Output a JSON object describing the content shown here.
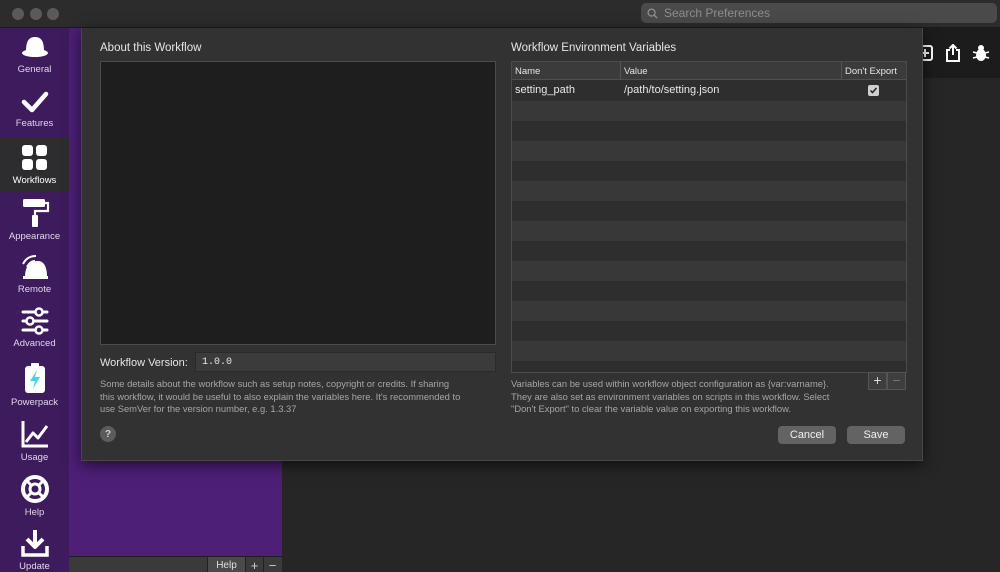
{
  "search": {
    "placeholder": "Search Preferences"
  },
  "nav": {
    "items": [
      {
        "label": "General",
        "icon": "hat-icon"
      },
      {
        "label": "Features",
        "icon": "checkmark-icon"
      },
      {
        "label": "Workflows",
        "icon": "grid-icon",
        "active": true
      },
      {
        "label": "Appearance",
        "icon": "paint-roller-icon"
      },
      {
        "label": "Remote",
        "icon": "remote-icon"
      },
      {
        "label": "Advanced",
        "icon": "sliders-icon"
      },
      {
        "label": "Powerpack",
        "icon": "battery-bolt-icon"
      },
      {
        "label": "Usage",
        "icon": "line-chart-icon"
      },
      {
        "label": "Help",
        "icon": "lifebuoy-icon"
      },
      {
        "label": "Update",
        "icon": "download-icon"
      }
    ]
  },
  "workflow_list_footer": {
    "help_label": "Help",
    "add_label": "+",
    "remove_label": "−"
  },
  "dialog": {
    "about_title": "About this Workflow",
    "version_label": "Workflow Version:",
    "version_value": "1.0.0",
    "about_note": {
      "line1": "Some details about the workflow such as setup notes, copyright or credits. If sharing",
      "line2": "this workflow, it would be useful to also explain the variables here. It's recommended to",
      "line3": "use SemVer for the version number, e.g. 1.3.37"
    },
    "env_title": "Workflow Environment Variables",
    "columns": [
      "Name",
      "Value",
      "Don't Export"
    ],
    "variables": [
      {
        "name": "setting_path",
        "value": "/path/to/setting.json",
        "dont_export": true
      }
    ],
    "add_label": "+",
    "remove_label": "−",
    "env_note": {
      "line1": "Variables can be used within workflow object configuration as {var:varname}.",
      "line2": "They are also set as environment variables on scripts in this workflow. Select",
      "line3": "\"Don't Export\" to clear the variable value on exporting this workflow."
    },
    "help_label": "?",
    "cancel_label": "Cancel",
    "save_label": "Save"
  },
  "colors": {
    "nav_background": "#3d1b5c",
    "workflow_list_background": "#4d1f77",
    "powerpack_accent": "#4fd1e0"
  }
}
